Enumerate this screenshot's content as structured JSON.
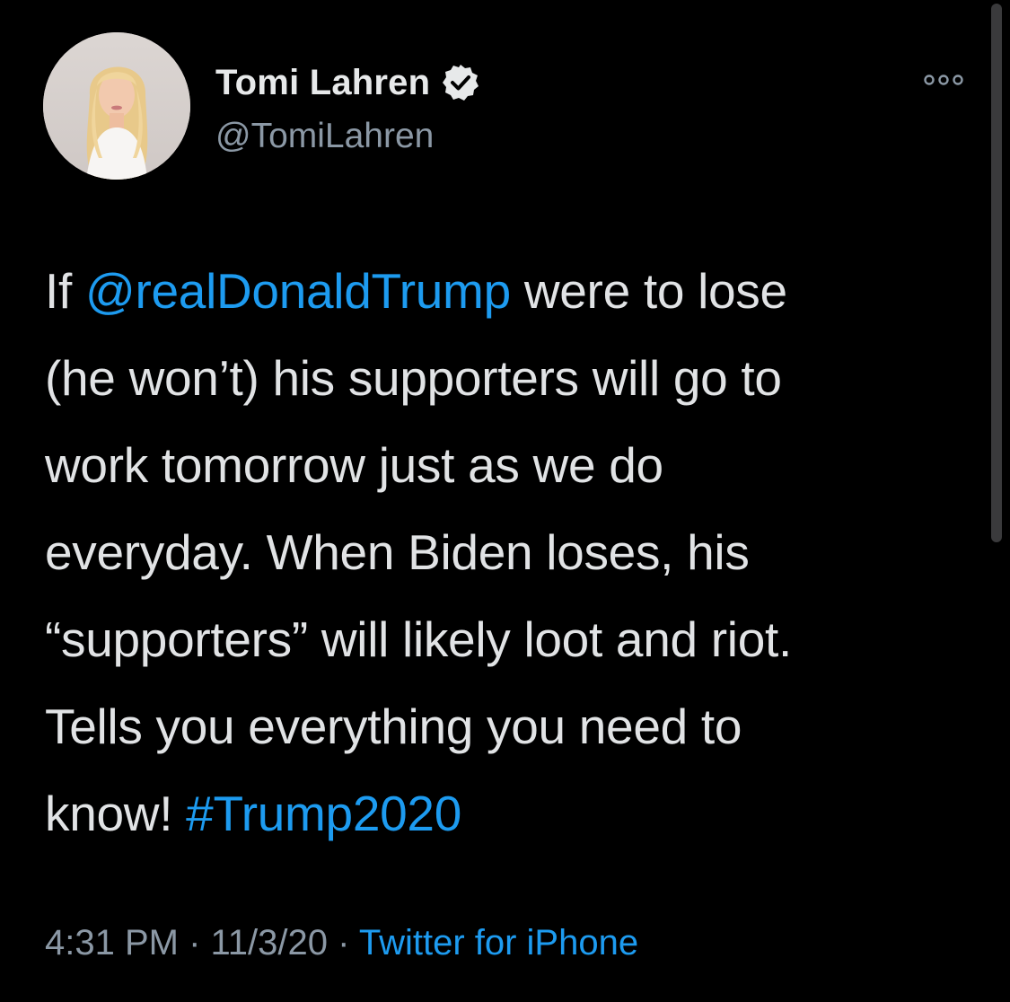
{
  "author": {
    "display_name": "Tomi Lahren",
    "handle": "@TomiLahren",
    "verified": true
  },
  "tweet": {
    "lines": [
      {
        "before": "If ",
        "mention": "@realDonaldTrump",
        "after": " were to lose"
      },
      {
        "text": "(he won’t) his supporters will go to"
      },
      {
        "text": "work tomorrow just as we do"
      },
      {
        "text": "everyday. When Biden loses, his"
      },
      {
        "text": "“supporters” will likely loot and riot."
      },
      {
        "text": "Tells you everything you need to"
      },
      {
        "before": "know! ",
        "hashtag": "#Trump2020"
      }
    ]
  },
  "meta": {
    "time": "4:31 PM",
    "sep1": " · ",
    "date": "11/3/20",
    "sep2": " · ",
    "source": "Twitter for iPhone"
  },
  "icons": {
    "verified": "verified-badge-icon",
    "more": "more-options-icon"
  },
  "colors": {
    "background": "#000000",
    "link": "#1d9bf0",
    "secondary_text": "#8b98a5",
    "primary_text": "#e1e3e5"
  }
}
